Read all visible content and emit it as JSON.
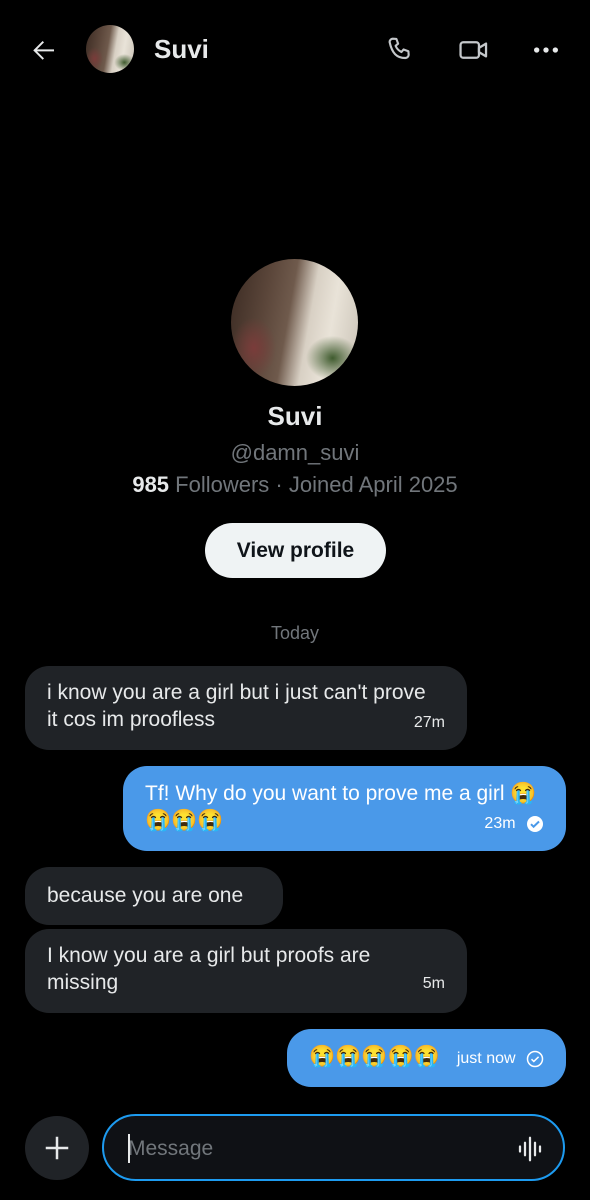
{
  "header": {
    "back_icon": "arrow-left-icon",
    "name": "Suvi",
    "call_icon": "phone-icon",
    "video_icon": "video-camera-icon",
    "more_icon": "more-horizontal-icon"
  },
  "profile": {
    "name": "Suvi",
    "handle": "@damn_suvi",
    "followers_count": "985",
    "followers_rest": "Followers · Joined April 2025",
    "view_profile_label": "View profile"
  },
  "day_label": "Today",
  "messages": [
    {
      "direction": "in",
      "text": "i know you are a girl but i just can't prove it cos im proofless",
      "time": "27m"
    },
    {
      "direction": "out",
      "text": "Tf! Why do you want to prove me a girl 😭😭😭😭",
      "time": "23m",
      "status": "read"
    },
    {
      "direction": "in",
      "text": "because you are one",
      "time": ""
    },
    {
      "direction": "in",
      "text": "I know you are a girl but proofs are missing",
      "time": "5m"
    },
    {
      "direction": "out",
      "text": "😭😭😭😭😭",
      "time": "just now",
      "status": "sent"
    }
  ],
  "composer": {
    "add_icon": "plus-icon",
    "placeholder": "Message",
    "voice_icon": "voice-waveform-icon"
  },
  "colors": {
    "background": "#000000",
    "incoming_bubble": "#202327",
    "outgoing_bubble": "#4a99e9",
    "accent": "#1d9bf0"
  }
}
